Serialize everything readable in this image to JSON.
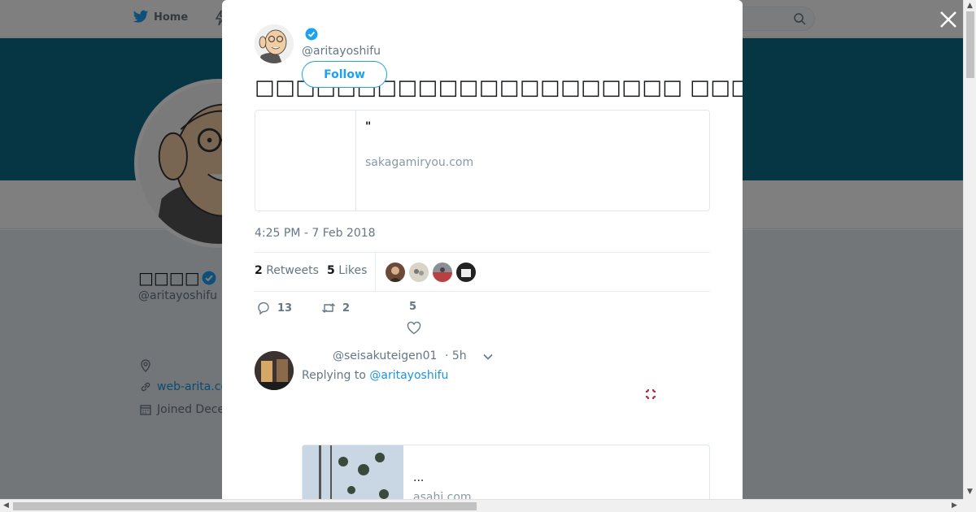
{
  "nav": {
    "home_label": "Home"
  },
  "profile": {
    "name": "□□□□",
    "handle": "@aritayoshifu",
    "website": "web-arita.co",
    "joined": "Joined Dece"
  },
  "tweet": {
    "handle": "@aritayoshifu",
    "follow_label": "Follow",
    "text": "□□□□□□□□□□□□□□□□□□□□□ □□□□□□□□□□□□ □□□□□□□□□□□□□□□□□□□□□□□□□□□□□□□",
    "card": {
      "title": "\"",
      "domain": "sakagamiryou.com"
    },
    "timestamp": "4:25 PM - 7 Feb 2018",
    "retweets_count": "2",
    "retweets_label": "Retweets",
    "likes_count": "5",
    "likes_label": "Likes",
    "reply_count": "13",
    "retweet_count": "2",
    "like_count": "5"
  },
  "reply": {
    "handle": "@seisakuteigen01",
    "time": "· 5h",
    "replying_prefix": "Replying to",
    "replying_to": "@aritayoshifu",
    "card": {
      "title": "...",
      "domain": "asahi.com"
    }
  },
  "colors": {
    "accent": "#1da1f2",
    "banner": "#0c6b88",
    "link": "#1b95e0"
  }
}
